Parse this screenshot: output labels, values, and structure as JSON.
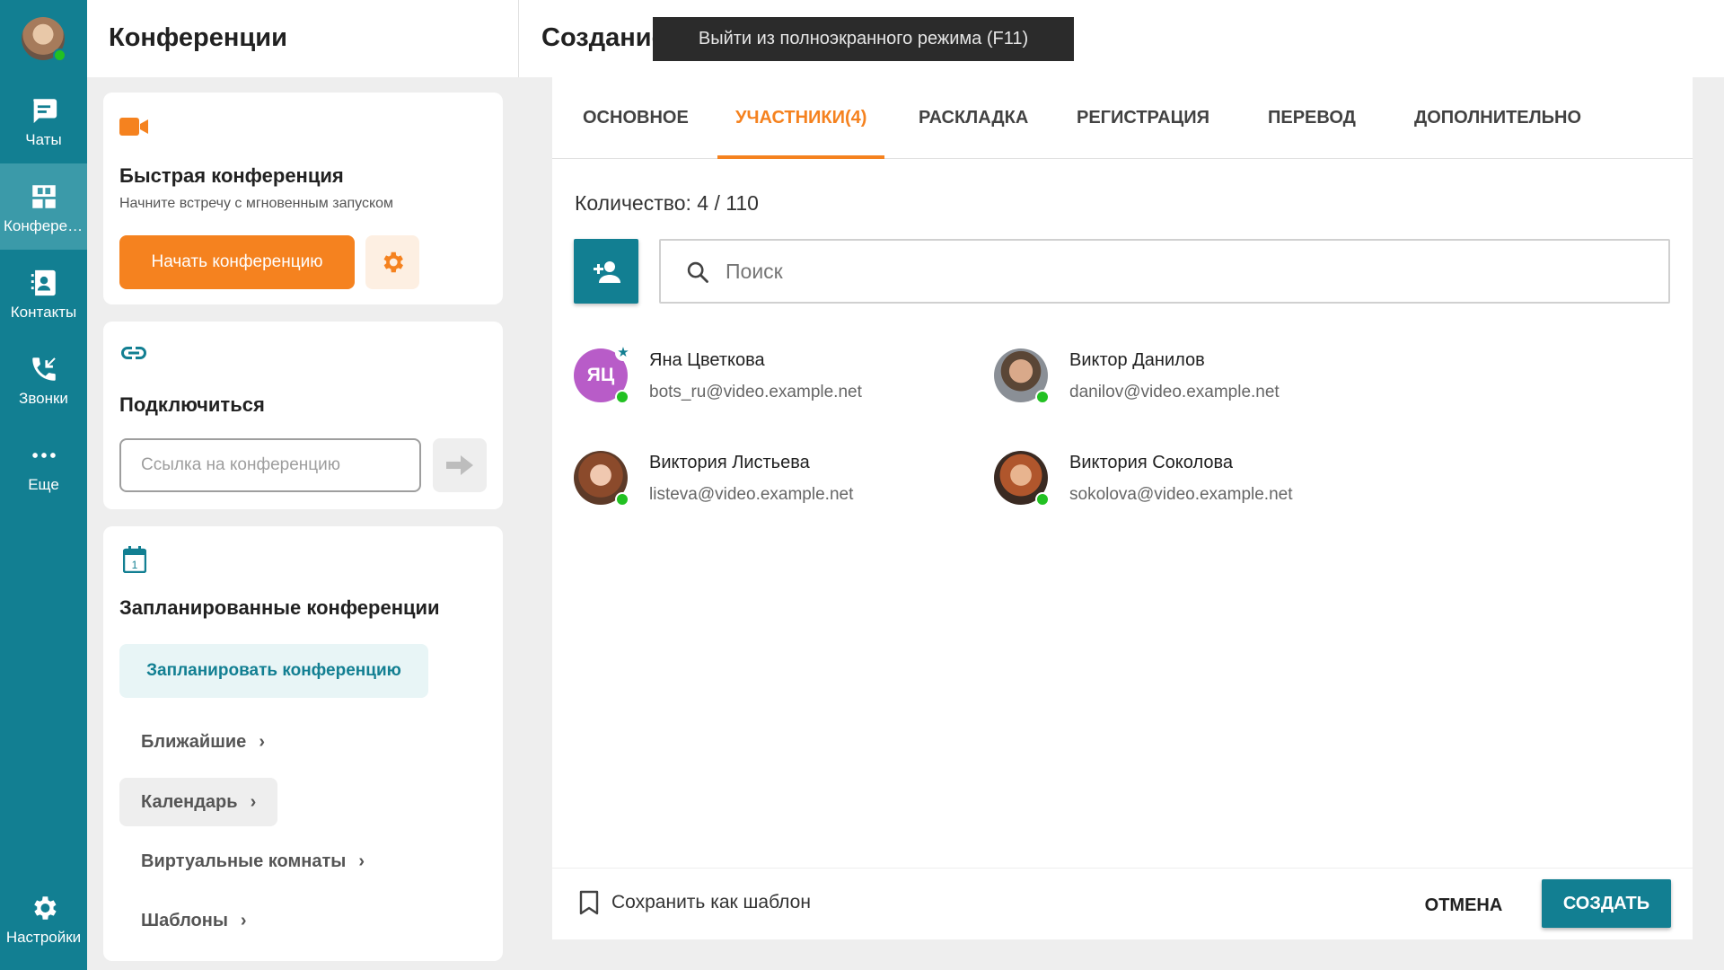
{
  "colors": {
    "teal": "#127f92",
    "orange": "#f5821f",
    "online": "#22c122"
  },
  "rail": {
    "items": [
      {
        "label": "Чаты",
        "icon": "chat-icon"
      },
      {
        "label": "Конференции",
        "icon": "conference-icon"
      },
      {
        "label": "Контакты",
        "icon": "contacts-icon"
      },
      {
        "label": "Звонки",
        "icon": "calls-icon"
      },
      {
        "label": "Еще",
        "icon": "more-icon"
      },
      {
        "label": "Настройки",
        "icon": "gear-icon"
      }
    ]
  },
  "middle": {
    "title": "Конференции",
    "quick": {
      "title": "Быстрая конференция",
      "subtitle": "Начните встречу с мгновенным запуском",
      "start_label": "Начать конференцию"
    },
    "connect": {
      "title": "Подключиться",
      "placeholder": "Ссылка на конференцию"
    },
    "scheduled": {
      "title": "Запланированные конференции",
      "schedule_label": "Запланировать конференцию",
      "links": [
        "Ближайшие",
        "Календарь",
        "Виртуальные комнаты",
        "Шаблоны"
      ]
    }
  },
  "right": {
    "title": "Создание конференции",
    "tooltip": "Выйти из полноэкранного режима (F11)",
    "tabs": [
      "ОСНОВНОЕ",
      "УЧАСТНИКИ(4)",
      "РАСКЛАДКА",
      "РЕГИСТРАЦИЯ",
      "ПЕРЕВОД",
      "ДОПОЛНИТЕЛЬНО"
    ],
    "count": "Количество: 4 / 110",
    "search_placeholder": "Поиск",
    "participants": [
      {
        "name": "Яна Цветкова",
        "email": "bots_ru@video.example.net",
        "initials": "ЯЦ"
      },
      {
        "name": "Виктор Данилов",
        "email": "danilov@video.example.net"
      },
      {
        "name": "Виктория Листьева",
        "email": "listeva@video.example.net"
      },
      {
        "name": "Виктория Соколова",
        "email": "sokolova@video.example.net"
      }
    ],
    "footer": {
      "save_template": "Сохранить как шаблон",
      "cancel": "ОТМЕНА",
      "create": "СОЗДАТЬ"
    }
  }
}
